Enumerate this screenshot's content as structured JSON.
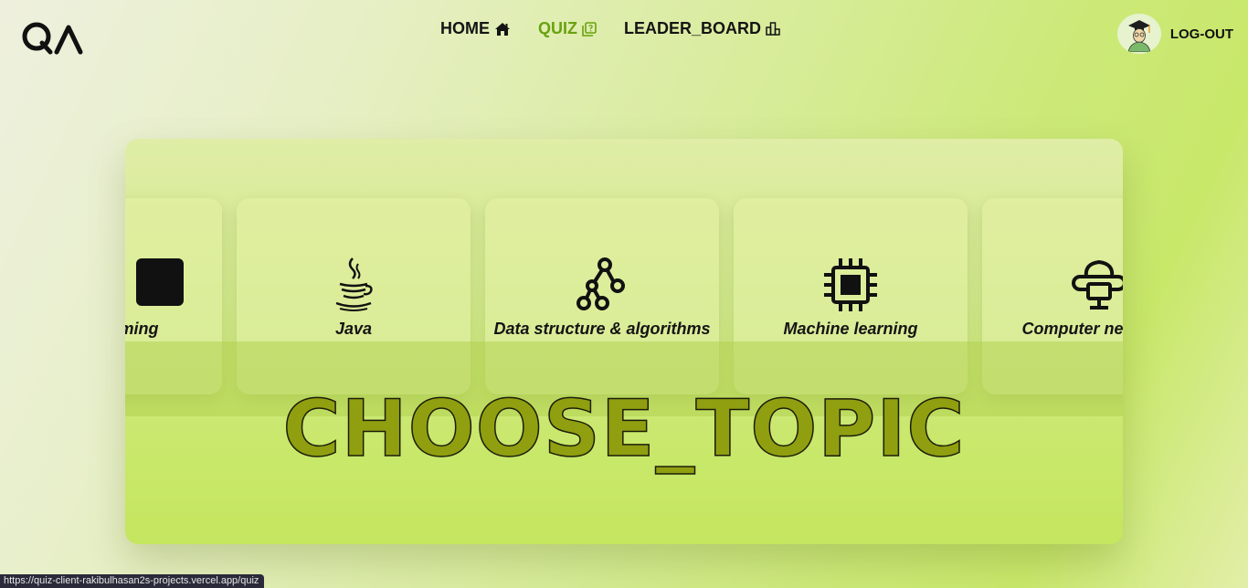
{
  "brand": {
    "logo_text": "QA"
  },
  "nav": {
    "items": [
      {
        "label": "HOME",
        "icon": "home-icon",
        "active": false
      },
      {
        "label": "QUIZ",
        "icon": "quiz-icon",
        "active": true
      },
      {
        "label": "LEADER_BOARD",
        "icon": "leaderboard-icon",
        "active": false
      }
    ]
  },
  "user": {
    "avatar": "graduate-avatar",
    "logout_label": "LOG-OUT"
  },
  "topics": [
    {
      "label": "Programming",
      "icon": "code-icon"
    },
    {
      "label": "Java",
      "icon": "java-icon"
    },
    {
      "label": "Data structure & algorithms",
      "icon": "graph-icon"
    },
    {
      "label": "Machine learning",
      "icon": "chip-icon"
    },
    {
      "label": "Computer networks",
      "icon": "network-icon"
    }
  ],
  "heading": "CHOOSE_TOPIC",
  "status_url": "https://quiz-client-rakibulhasan2s-projects.vercel.app/quiz",
  "colors": {
    "accent": "#6aa10f",
    "heading_fill": "#8f9f10",
    "status_bg": "#2a2a3a"
  }
}
